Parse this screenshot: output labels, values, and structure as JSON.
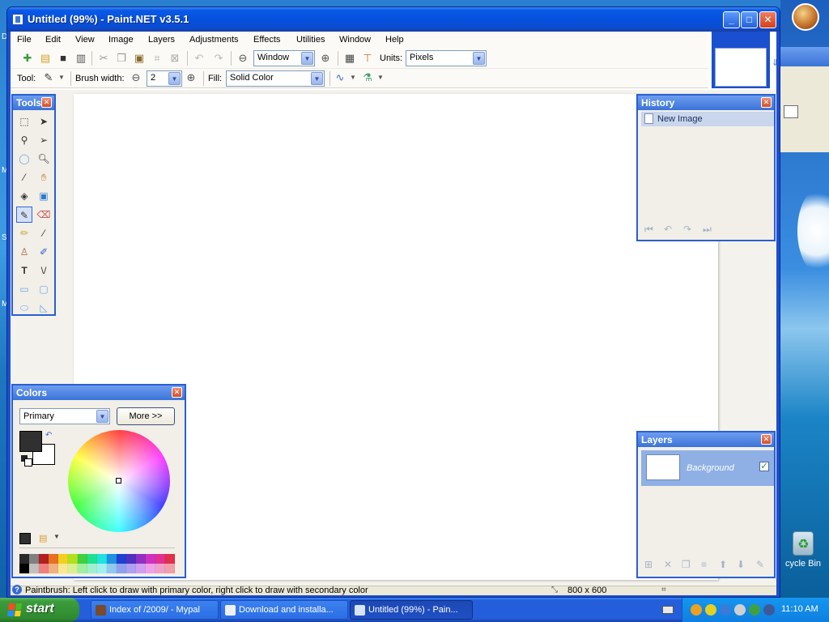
{
  "window": {
    "title": "Untitled (99%) - Paint.NET v3.5.1",
    "min_label": "_",
    "max_label": "□",
    "close_label": "✕"
  },
  "menu": [
    "File",
    "Edit",
    "View",
    "Image",
    "Layers",
    "Adjustments",
    "Effects",
    "Utilities",
    "Window",
    "Help"
  ],
  "toolbar": {
    "zoom_value": "Window",
    "units_label": "Units:",
    "units_value": "Pixels",
    "tool_label": "Tool:",
    "brush_width_label": "Brush width:",
    "brush_width_value": "2",
    "fill_label": "Fill:",
    "fill_value": "Solid Color"
  },
  "tools_panel": {
    "title": "Tools",
    "close": "✕"
  },
  "history_panel": {
    "title": "History",
    "close": "✕",
    "items": [
      "New Image"
    ]
  },
  "layers_panel": {
    "title": "Layers",
    "close": "✕",
    "layers": [
      {
        "name": "Background",
        "visible": true
      }
    ]
  },
  "colors_panel": {
    "title": "Colors",
    "close": "✕",
    "mode_value": "Primary",
    "more_label": "More >>",
    "primary_color": "#303030",
    "secondary_color": "#ffffff"
  },
  "statusbar": {
    "help_icon": "?",
    "text": "Paintbrush: Left click to draw with primary color, right click to draw with secondary color",
    "image_size": "800 x 600"
  },
  "desktop": {
    "recycle_label": "cycle Bin",
    "left_letters": [
      "D",
      "M",
      "S",
      "M"
    ]
  },
  "taskbar": {
    "start_label": "start",
    "tasks": [
      {
        "label": "Index of /2009/ - Mypal",
        "active": false
      },
      {
        "label": "Download and installa...",
        "active": false
      },
      {
        "label": "Untitled (99%) - Pain...",
        "active": true
      }
    ],
    "clock": "11:10 AM"
  }
}
